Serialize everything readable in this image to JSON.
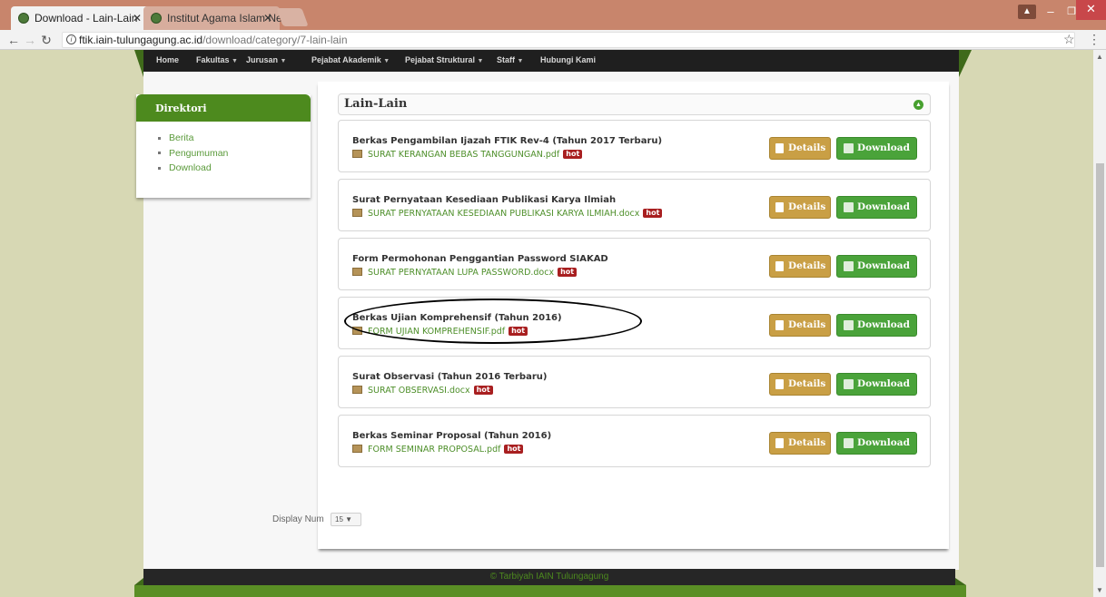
{
  "browser": {
    "tabs": [
      {
        "label": "Download - Lain-Lain",
        "active": true
      },
      {
        "label": "Institut Agama Islam Ne",
        "active": false
      }
    ],
    "url_host": "ftik.iain-tulungagung.ac.id",
    "url_path": "/download/category/7-lain-lain"
  },
  "topnav": {
    "items": [
      "Home",
      "Fakultas",
      "Jurusan",
      "Pejabat Akademik",
      "Pejabat Struktural",
      "Staff",
      "Hubungi Kami"
    ]
  },
  "sidebar": {
    "title": "Direktori",
    "items": [
      {
        "label": "Berita"
      },
      {
        "label": "Pengumuman"
      },
      {
        "label": "Download"
      }
    ]
  },
  "category": {
    "title": "Lain-Lain"
  },
  "documents": [
    {
      "title": "Berkas Pengambilan Ijazah FTIK Rev-4 (Tahun 2017 Terbaru)",
      "file": "SURAT KERANGAN BEBAS TANGGUNGAN.pdf",
      "badge": "hot"
    },
    {
      "title": "Surat Pernyataan Kesediaan Publikasi Karya Ilmiah",
      "file": "SURAT PERNYATAAN KESEDIAAN PUBLIKASI KARYA ILMIAH.docx",
      "badge": "hot"
    },
    {
      "title": "Form Permohonan Penggantian Password SIAKAD",
      "file": "SURAT PERNYATAAN LUPA PASSWORD.docx",
      "badge": "hot"
    },
    {
      "title": "Berkas Ujian Komprehensif (Tahun 2016)",
      "file": "FORM UJIAN KOMPREHENSIF.pdf",
      "badge": "hot"
    },
    {
      "title": "Surat Observasi (Tahun 2016 Terbaru)",
      "file": "SURAT OBSERVASI.docx",
      "badge": "hot"
    },
    {
      "title": "Berkas Seminar Proposal (Tahun 2016)",
      "file": "FORM SEMINAR PROPOSAL.pdf",
      "badge": "hot"
    }
  ],
  "buttons": {
    "details": "Details",
    "download": "Download"
  },
  "pagination": {
    "label": "Display Num",
    "value": "15"
  },
  "footer": {
    "text": "© Tarbiyah IAIN Tulungagung"
  },
  "colors": {
    "accent_green": "#4d8a1e",
    "details_gold": "#c99f45",
    "download_green": "#4aa33a",
    "hot_red": "#a81f20"
  }
}
